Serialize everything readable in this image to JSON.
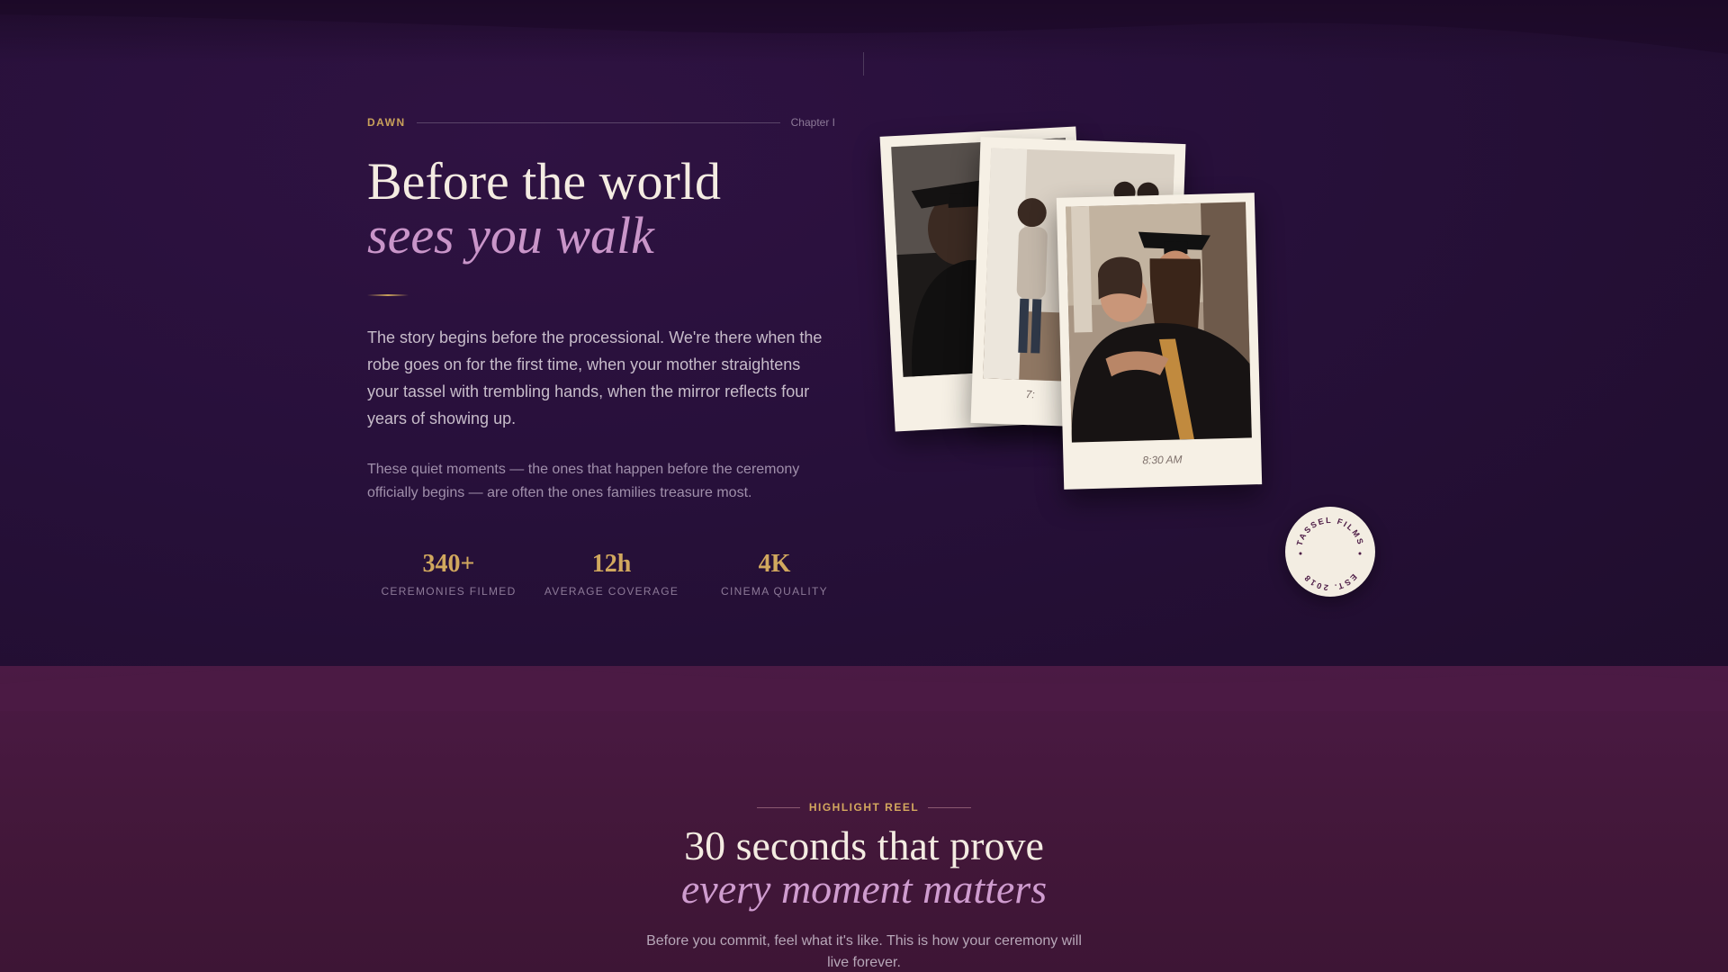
{
  "chapter": {
    "label": "DAWN",
    "number": "Chapter I"
  },
  "hero": {
    "title_line1": "Before the world",
    "title_line2": "sees you walk",
    "lead": "The story begins before the processional. We're there when the robe goes on for the first time, when your mother straightens your tassel with trembling hands, when the mirror reflects four years of showing up.",
    "sub": "These quiet moments — the ones that happen before the ceremony officially begins — are often the ones families treasure most."
  },
  "stats": [
    {
      "value": "340+",
      "label": "CEREMONIES FILMED"
    },
    {
      "value": "12h",
      "label": "AVERAGE COVERAGE"
    },
    {
      "value": "4K",
      "label": "CINEMA QUALITY"
    }
  ],
  "polaroids": [
    {
      "caption": "",
      "subject": "graduate in cap from behind"
    },
    {
      "caption": "7:",
      "subject": "family helping with robe"
    },
    {
      "caption": "8:30 AM",
      "subject": "mother hugging graduate"
    }
  ],
  "stamp": {
    "top_text": "TASSEL FILMS",
    "bottom_text": "EST. 2018"
  },
  "highlight": {
    "label": "HIGHLIGHT REEL",
    "title_line1": "30 seconds that prove",
    "title_line2": "every moment matters",
    "sub": "Before you commit, feel what it's like. This is how your ceremony will live forever."
  },
  "colors": {
    "background_top": "#27103a",
    "background_bottom": "#4b1a44",
    "accent_gold": "#d1a85e",
    "accent_pink": "#c995c9",
    "text_light": "#f4ece2"
  }
}
